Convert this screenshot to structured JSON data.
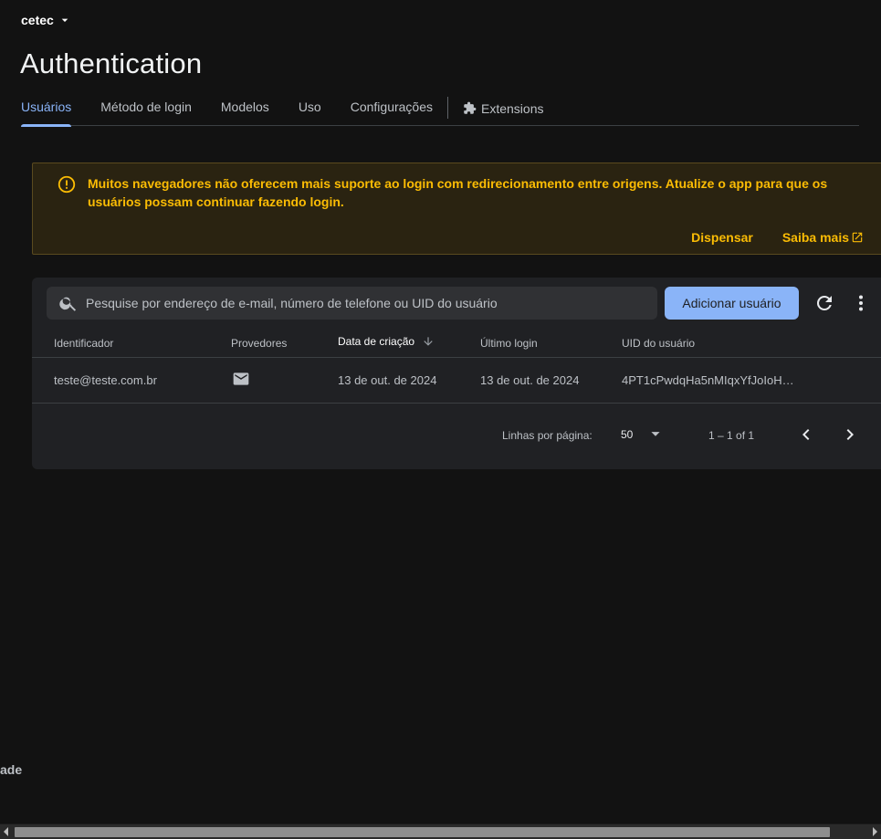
{
  "project": {
    "name": "cetec"
  },
  "page": {
    "title": "Authentication"
  },
  "tabs": [
    {
      "label": "Usuários",
      "active": true
    },
    {
      "label": "Método de login"
    },
    {
      "label": "Modelos"
    },
    {
      "label": "Uso"
    },
    {
      "label": "Configurações"
    },
    {
      "label": "Extensions",
      "icon": "puzzle-icon"
    }
  ],
  "banner": {
    "icon": "warning-icon",
    "message": "Muitos navegadores não oferecem mais suporte ao login com redirecionamento entre origens. Atualize o app para que os usuários possam continuar fazendo login.",
    "dismiss_label": "Dispensar",
    "learn_more_label": "Saiba mais",
    "color": "#fbbc04"
  },
  "users": {
    "search_placeholder": "Pesquise por endereço de e-mail, número de telefone ou UID do usuário",
    "add_button_label": "Adicionar usuário",
    "columns": [
      "Identificador",
      "Provedores",
      "Data de criação",
      "Último login",
      "UID do usuário"
    ],
    "sorted_column": "Data de criação",
    "rows": [
      {
        "identifier": "teste@teste.com.br",
        "provider": "email-icon",
        "created": "13 de out. de 2024",
        "last_login": "13 de out. de 2024",
        "uid": "4PT1cPwdqHa5nMIqxYfJoIoH…"
      }
    ],
    "pagination": {
      "rows_per_page_label": "Linhas por página:",
      "rows_per_page": "50",
      "range": "1 – 1 of 1"
    }
  },
  "side_fragment": "ade",
  "colors": {
    "accent": "#8ab4f8",
    "warning": "#fbbc04",
    "background": "#121212",
    "card": "#202124"
  }
}
